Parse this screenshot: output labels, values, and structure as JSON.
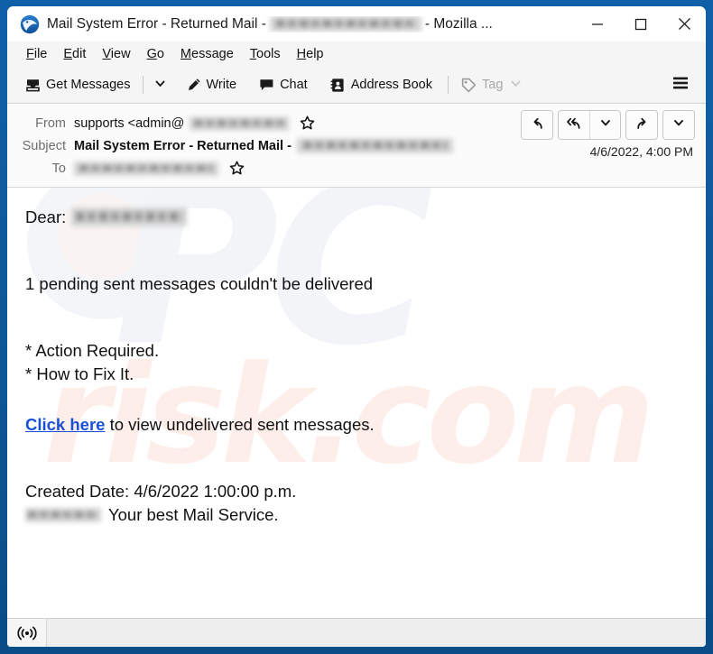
{
  "window": {
    "app_icon": "thunderbird-icon",
    "title_prefix": "Mail System Error - Returned Mail - ",
    "title_redacted": "[redacted-email]",
    "title_suffix": " - Mozilla ...",
    "controls": {
      "minimize": "minimize-icon",
      "maximize": "maximize-icon",
      "close": "close-icon"
    },
    "frame_color": "#0d5795"
  },
  "menubar": {
    "items": [
      {
        "accel": "F",
        "rest": "ile"
      },
      {
        "accel": "E",
        "rest": "dit"
      },
      {
        "accel": "V",
        "rest": "iew"
      },
      {
        "accel": "G",
        "rest": "o"
      },
      {
        "accel": "M",
        "rest": "essage"
      },
      {
        "accel": "T",
        "rest": "ools"
      },
      {
        "accel": "H",
        "rest": "elp"
      }
    ]
  },
  "toolbar": {
    "get_messages_label": "Get Messages",
    "get_messages_icon": "inbox-download-icon",
    "get_messages_caret": "chevron-down-icon",
    "write_label": "Write",
    "write_icon": "pencil-icon",
    "chat_label": "Chat",
    "chat_icon": "speech-bubble-icon",
    "address_book_label": "Address Book",
    "address_book_icon": "address-book-icon",
    "tag_label": "Tag",
    "tag_icon": "tag-icon",
    "tag_caret": "chevron-down-icon",
    "tag_disabled": true,
    "app_menu_icon": "hamburger-menu-icon"
  },
  "message_header": {
    "from_label": "From",
    "from_value": "supports <admin@",
    "from_redacted": "[redacted-domain]",
    "from_star": "star-icon",
    "subject_label": "Subject",
    "subject_value": "Mail System Error - Returned Mail - ",
    "subject_redacted": "[redacted-email]",
    "to_label": "To",
    "to_redacted": "[redacted-email]",
    "to_star": "star-icon",
    "date": "4/6/2022, 4:00 PM",
    "actions": {
      "reply": "reply-icon",
      "reply_all": "reply-all-icon",
      "reply_all_caret": "chevron-down-icon",
      "forward": "forward-icon",
      "more_caret": "chevron-down-icon"
    }
  },
  "message_body": {
    "greeting_label": "Dear:",
    "greeting_redacted": "[redacted-name]",
    "line_notice": "1 pending sent messages couldn't be delivered",
    "line_action": "* Action Required.",
    "line_howto": "* How to Fix It.",
    "link_text": "Click here",
    "link_rest": " to view undelivered sent messages.",
    "line_created": "Created Date: 4/6/2022 1:00:00 p.m.",
    "signature_redacted": "[redacted-brand]",
    "signature_text": "Your best Mail Service.",
    "link_color": "#1a4fd6"
  },
  "statusbar": {
    "connection_icon": "broadcast-online-icon",
    "text": ""
  }
}
